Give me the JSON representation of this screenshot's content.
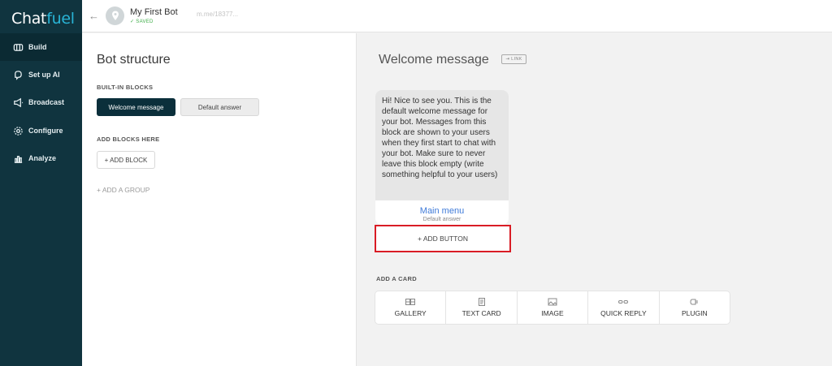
{
  "logo": {
    "part1": "Chat",
    "part2": "fuel"
  },
  "sidebar": {
    "items": [
      {
        "label": "Build",
        "icon": "build-icon",
        "active": true
      },
      {
        "label": "Set up AI",
        "icon": "ai-icon",
        "active": false
      },
      {
        "label": "Broadcast",
        "icon": "megaphone-icon",
        "active": false
      },
      {
        "label": "Configure",
        "icon": "gear-icon",
        "active": false
      },
      {
        "label": "Analyze",
        "icon": "bar-chart-icon",
        "active": false
      }
    ]
  },
  "topbar": {
    "back": "←",
    "bot_name": "My First Bot",
    "status": "✓ SAVED",
    "link": "m.me/18377..."
  },
  "structure": {
    "title": "Bot structure",
    "builtin_label": "BUILT-IN BLOCKS",
    "welcome_label": "Welcome message",
    "default_label": "Default answer",
    "add_blocks_label": "ADD BLOCKS HERE",
    "add_block_btn": "+ ADD BLOCK",
    "add_group": "+ ADD A GROUP"
  },
  "main": {
    "title": "Welcome message",
    "link_tag": "⇥ LINK",
    "card_text": "Hi! Nice to see you. This is the default welcome message for your bot. Messages from this block are shown to your users when they first start to chat with your bot. Make sure to never leave this block empty (write something helpful to your users)",
    "card_button_title": "Main menu",
    "card_button_sub": "Default answer",
    "add_button": "+ ADD BUTTON",
    "add_card_label": "ADD A CARD",
    "card_types": [
      {
        "label": "GALLERY",
        "icon": "gallery-icon"
      },
      {
        "label": "TEXT CARD",
        "icon": "text-card-icon"
      },
      {
        "label": "IMAGE",
        "icon": "image-icon"
      },
      {
        "label": "QUICK REPLY",
        "icon": "quick-reply-icon"
      },
      {
        "label": "PLUGIN",
        "icon": "plugin-icon"
      }
    ]
  },
  "colors": {
    "sidebar_bg": "#10343f",
    "brand_accent": "#29b4d6",
    "saved_green": "#3fae49",
    "highlight_red": "#d91c25",
    "link_blue": "#3f7bd9"
  }
}
